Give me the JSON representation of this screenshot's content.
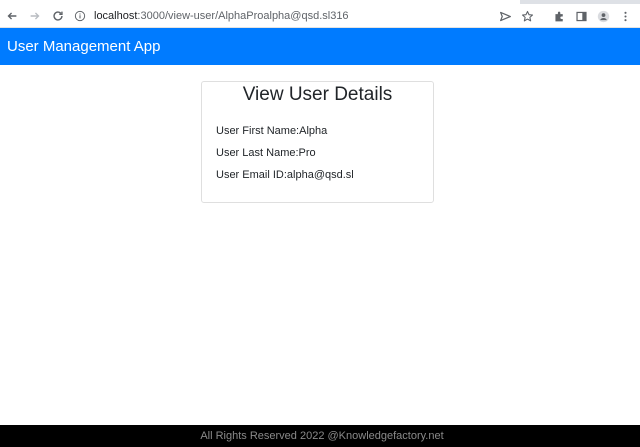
{
  "browser": {
    "url_host": "localhost",
    "url_path": ":3000/view-user/AlphaProalpha@qsd.sl316",
    "icons": [
      "back-icon",
      "forward-icon",
      "reload-icon",
      "info-icon",
      "send-icon",
      "star-icon",
      "extensions-icon",
      "sidebar-icon",
      "profile-icon",
      "menu-icon"
    ]
  },
  "navbar": {
    "brand": "User Management App",
    "color": "#007bff"
  },
  "card": {
    "title": "View User Details",
    "first_name_label": "User First Name:",
    "first_name_value": "Alpha",
    "last_name_label": "User Last Name:",
    "last_name_value": "Pro",
    "email_label": "User Email ID:",
    "email_value": "alpha@qsd.sl"
  },
  "footer": {
    "text": "All Rights Reserved 2022 @Knowledgefactory.net"
  }
}
